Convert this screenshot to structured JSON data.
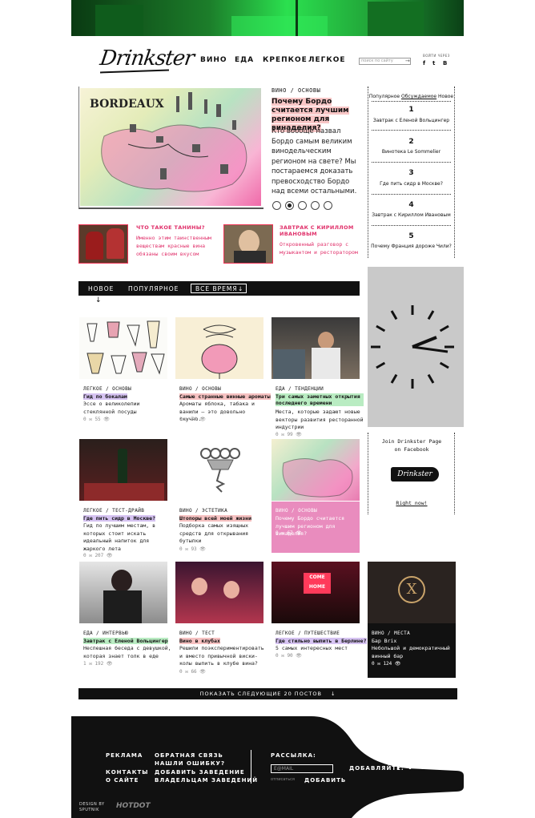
{
  "header": {
    "logo": "Drinkster",
    "nav": [
      "ВИНО",
      "ЕДА",
      "КРЕПКОЕ",
      "ЛЕГКОЕ"
    ],
    "search_placeholder": "поиск по сайту",
    "login_label": "ВОЙТИ ЧЕРЕЗ",
    "social": [
      "f",
      "t",
      "B"
    ]
  },
  "hero": {
    "image_caption": "BORDEAUX",
    "category": "ВИНО / ОСНОВЫ",
    "title": "Почему Бордо считается лучшим регионом для винаделия?",
    "description": "Кто вообще назвал Бордо самым великим винодельческим регионом на свете? Мы постараемся доказать превосходство Бордо над всеми остальными.",
    "slides": 5,
    "active_slide": 2
  },
  "teasers": [
    {
      "title": "ЧТО ТАКОЕ ТАНИНЫ?",
      "desc": "Именно этим таинственным веществам красные вина обязаны своим вкусом"
    },
    {
      "title": "ЗАВТРАК С КИРИЛЛОМ ИВАНОВЫМ",
      "desc": "Откровенный разговор с музыкантом и ресторатором"
    }
  ],
  "popular": {
    "tabs": [
      "Популярное",
      "Обсуждаемое",
      "Новое"
    ],
    "items": [
      {
        "num": "1",
        "text": "Завтрак с Еленой Вольцингер"
      },
      {
        "num": "2",
        "text": "Винотека Le Sommelier"
      },
      {
        "num": "3",
        "text": "Где пить сидр в Москве?"
      },
      {
        "num": "4",
        "text": "Завтрак с Кириллом Ивановым"
      },
      {
        "num": "5",
        "text": "Почему Франция дороже Чили?"
      }
    ]
  },
  "tabs": {
    "new": "НОВОЕ",
    "popular": "ПОПУЛЯРНОЕ",
    "alltime": "ВСЕ ВРЕМЯ"
  },
  "facebook": {
    "text": "Join Drinkster Page on Facebook",
    "logo": "Drinkster",
    "link": "Right now!"
  },
  "cards": [
    {
      "cat": "ЛЕГКОЕ / ОСНОВЫ",
      "title": "Гид по бокалам",
      "desc": "Эссе о великолепии стеклянной посуды",
      "meta": "0 ✉ 55 👁",
      "hl": "#d6c3f2"
    },
    {
      "cat": "ВИНО / ОСНОВЫ",
      "title": "Самые странные винные ароматы",
      "desc": "Ароматы яблока, табака и ванили – это довольно скучно.",
      "meta": "0 ✉ 74 👁",
      "hl": "#f6c1c1"
    },
    {
      "cat": "ЕДА / ТЕНДЕНЦИИ",
      "title": "Три самых заметных открытия последнего времени",
      "desc": "Места, которые задают новые векторы развития ресторанной индустрии",
      "meta": "0 ✉ 99 👁",
      "hl": "#b9ecc2"
    },
    {
      "cat": "ЛЕГКОЕ / ТЕСТ-ДРАЙВ",
      "title": "Где пить сидр в Москве?",
      "desc": "Гид по лучшим местам, в которых стоит искать идеальный напиток для жаркого лета",
      "meta": "0 ✉ 207 👁",
      "hl": "#d6c3f2"
    },
    {
      "cat": "ВИНО / ЭСТЕТИКА",
      "title": "Штопоры всей моей жизни",
      "desc": "Подборка самых изящных средств для открывания бутылки",
      "meta": "0 ✉ 93 👁",
      "hl": "#f6c1c1"
    },
    {
      "cat": "ВИНО / ОСНОВЫ",
      "title": "",
      "desc": "Почему Бордо считается лучшим регионом для винаделия?",
      "meta": "0 ✉ 67 👁",
      "hl": ""
    },
    {
      "cat": "ЕДА / ИНТЕРВЬЮ",
      "title": "Завтрак с Еленой Вольцингер",
      "desc": "Неспешная беседа с девушкой, которая знает толк в еде",
      "meta": "1 ✉ 192 👁",
      "hl": "#b9ecc2"
    },
    {
      "cat": "ВИНО / ТЕСТ",
      "title": "Вино в клубах",
      "desc": "Решили поэкспериментировать и вместо привычной виски-колы выпить в клубе вина?",
      "meta": "0 ✉ 66 👁",
      "hl": "#f6c1c1"
    },
    {
      "cat": "ЛЕГКОЕ / ПУТЕШЕСТВИЕ",
      "title": "Где стильно выпить в Берлине?",
      "desc": "5 самых интересных мест",
      "meta": "0 ✉ 90 👁",
      "hl": "#d6c3f2"
    },
    {
      "cat": "ВИНО / МЕСТА",
      "title": "Бар Brix",
      "desc": "Небольшой и демократичный винный бар",
      "meta": "0 ✉ 124 👁",
      "hl": ""
    }
  ],
  "loadmore": "ПОКАЗАТЬ СЛЕДУЮЩИЕ 20 ПОСТОВ",
  "footer": {
    "col1": [
      "РЕКЛАМА",
      "КОНТАКТЫ",
      "О САЙТЕ"
    ],
    "col2": [
      "ОБРАТНАЯ СВЯЗЬ",
      "НАШЛИ ОШИБКУ?",
      "ДОБАВИТЬ ЗАВЕДЕНИЕ",
      "ВЛАДЕЛЬЦАМ ЗАВЕДЕНИЙ"
    ],
    "subscribe_label": "РАССЫЛКА:",
    "email_placeholder": "E@MAIL",
    "unsubscribe": "отписаться",
    "add": "ДОБАВИТЬ",
    "add_social_label": "ДОБАВЛЯЙТЕ:",
    "design_by": "DESIGN BY SPUTNIK",
    "hotdot": "HOTDOT"
  }
}
